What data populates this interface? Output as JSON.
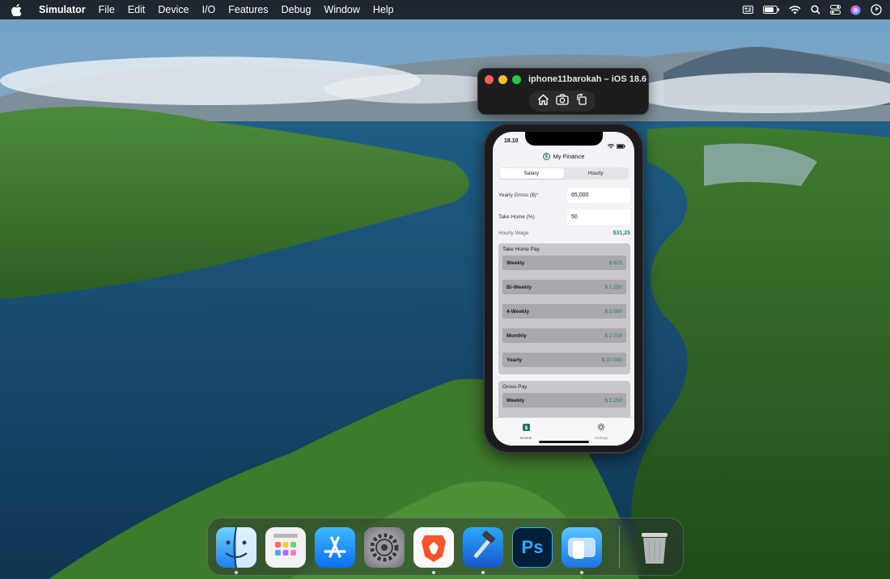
{
  "menubar": {
    "items": [
      {
        "label": "Simulator",
        "bold": true
      },
      {
        "label": "File"
      },
      {
        "label": "Edit"
      },
      {
        "label": "Device"
      },
      {
        "label": "I/O"
      },
      {
        "label": "Features"
      },
      {
        "label": "Debug"
      },
      {
        "label": "Window"
      },
      {
        "label": "Help"
      }
    ],
    "status_icons": [
      "display-icon",
      "battery-icon",
      "wifi-icon",
      "search-icon",
      "control-center-icon",
      "siri-icon",
      "clock-icon"
    ]
  },
  "simulator": {
    "title": "iphone11barokah – iOS 18.6",
    "tools": [
      "home-icon",
      "screenshot-icon",
      "rotate-icon"
    ]
  },
  "phone": {
    "status_time": "18.10",
    "nav_title": "My Finance",
    "nav_logo": "$",
    "segments": [
      {
        "label": "Salary",
        "active": true
      },
      {
        "label": "Hourly",
        "active": false
      }
    ],
    "fields": [
      {
        "label": "Yearly Gross ($)",
        "required_mark": "*",
        "value": "65,000"
      },
      {
        "label": "Take Home (%)",
        "value": "50"
      }
    ],
    "hourly_wage": {
      "label": "Hourly Wage",
      "value": "$31,25"
    },
    "take_home_card": {
      "title": "Take Home Pay",
      "rows": [
        {
          "name": "Weekly",
          "value": "$ 625"
        },
        {
          "name": "Bi-Weekly",
          "value": "$ 1.250"
        },
        {
          "name": "4-Weekly",
          "value": "$ 2.500"
        },
        {
          "name": "Monthly",
          "value": "$ 2.708"
        },
        {
          "name": "Yearly",
          "value": "$ 32.500"
        }
      ]
    },
    "gross_card": {
      "title": "Gross Pay",
      "rows": [
        {
          "name": "Weekly",
          "value": "$ 1.250"
        }
      ]
    },
    "tabs": [
      {
        "label": "Income",
        "icon": "dollar-icon",
        "active": true
      },
      {
        "label": "Settings",
        "icon": "gear-icon",
        "active": false
      }
    ]
  },
  "dock": {
    "apps": [
      "finder-icon",
      "launchpad-icon",
      "app-store-icon",
      "system-settings-icon",
      "brave-browser-icon",
      "xcode-icon",
      "photoshop-icon",
      "simulator-icon",
      "trash-icon"
    ],
    "photoshop_label": "Ps"
  }
}
